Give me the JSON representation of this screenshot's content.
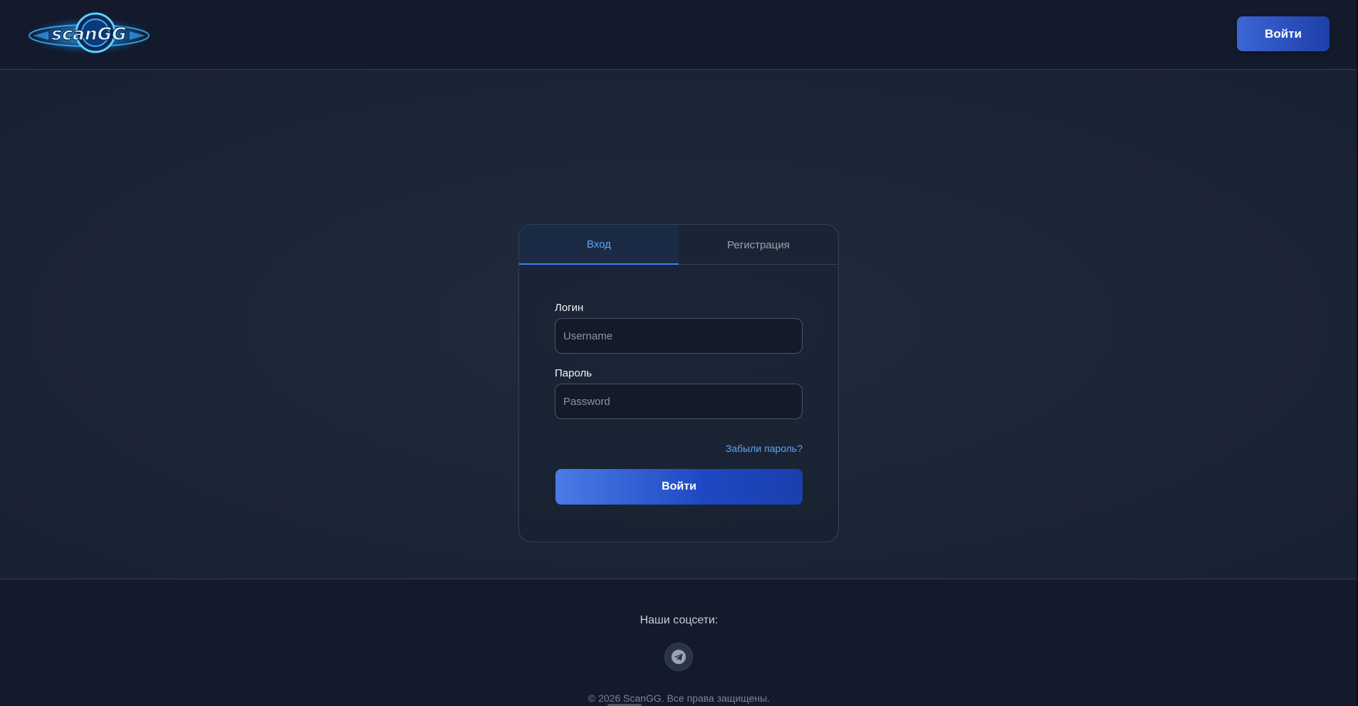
{
  "header": {
    "logo_text": "scanGG",
    "login_button": "Войти"
  },
  "auth_card": {
    "tabs": [
      {
        "label": "Вход",
        "active": true
      },
      {
        "label": "Регистрация",
        "active": false
      }
    ],
    "login_label": "Логин",
    "login_placeholder": "Username",
    "password_label": "Пароль",
    "password_placeholder": "Password",
    "forgot_link": "Забыли пароль?",
    "submit_button": "Войти"
  },
  "footer": {
    "socials_title": "Наши соцсети:",
    "social_icons": [
      "telegram-icon"
    ],
    "copyright": "© 2026 ScanGG. Все права защищены."
  },
  "colors": {
    "accent": "#3b82f6",
    "link": "#60a5fa",
    "background": "#1c2536"
  }
}
